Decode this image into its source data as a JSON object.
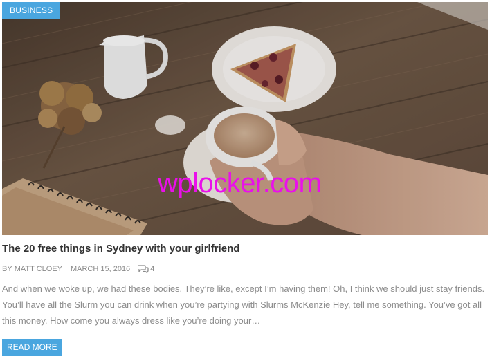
{
  "post": {
    "category": "BUSINESS",
    "title": "The 20 free things in Sydney with your girlfriend",
    "author_prefix": "BY",
    "author": "MATT CLOEY",
    "date": "MARCH 15, 2016",
    "comment_count": "4",
    "excerpt": "And when we woke up, we had these bodies. They’re like, except I’m having them! Oh, I think we should just stay friends. You’ll have all the Slurm you can drink when you’re partying with Slurms McKenzie Hey, tell me something. You’ve got all this money. How come you always dress like you’re doing your…",
    "read_more_label": "READ MORE"
  },
  "watermark": "wplocker.com",
  "image": {
    "description_icon": "photo-coffee-table"
  },
  "colors": {
    "accent": "#4aa6df",
    "watermark": "#ea10ea",
    "title": "#333333",
    "meta": "#8a8a8a",
    "excerpt": "#8c8c8c"
  }
}
